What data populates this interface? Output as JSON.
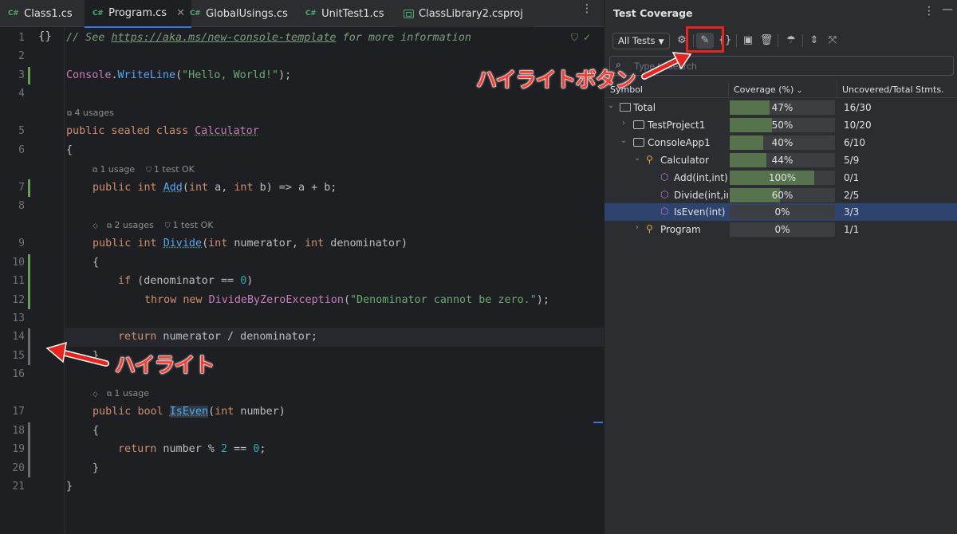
{
  "editor": {
    "tabs": [
      {
        "label": "Class1.cs",
        "icon": "C#"
      },
      {
        "label": "Program.cs",
        "icon": "C#",
        "active": true
      },
      {
        "label": "GlobalUsings.cs",
        "icon": "C#"
      },
      {
        "label": "UnitTest1.cs",
        "icon": "C#"
      },
      {
        "label": "ClassLibrary2.csproj",
        "icon": "project"
      }
    ],
    "close_glyph": "✕",
    "more_glyph": "⋮",
    "braces_icon": "{}",
    "status_icons": [
      "shield-check-icon",
      "check-icon"
    ],
    "line_numbers": [
      "1",
      "2",
      "3",
      "4",
      "5",
      "6",
      "7",
      "8",
      "9",
      "10",
      "11",
      "12",
      "13",
      "14",
      "15",
      "16",
      "17",
      "18",
      "19",
      "20",
      "21"
    ],
    "hints": {
      "h1": "4 usages",
      "h2a": "1 usage",
      "h2b": "1 test OK",
      "h3a": "2 usages",
      "h3b": "1 test OK",
      "h4": "1 usage"
    },
    "code": {
      "l1_comment": "// See ",
      "l1_link": "https://aka.ms/new-console-template",
      "l1_tail": " for more information",
      "l3_a": "Console",
      "l3_b": ".",
      "l3_c": "WriteLine",
      "l3_d": "(",
      "l3_e": "\"Hello, World!\"",
      "l3_f": ");",
      "l5_kw": "public sealed class ",
      "l5_name": "Calculator",
      "l6": "{",
      "l7_kw1": "public ",
      "l7_kw2": "int ",
      "l7_name": "Add",
      "l7_p1": "(",
      "l7_kw3": "int",
      "l7_p2": " a, ",
      "l7_kw4": "int",
      "l7_p3": " b) => a + b;",
      "l9_kw1": "public ",
      "l9_kw2": "int ",
      "l9_name": "Divide",
      "l9_p1": "(",
      "l9_kw3": "int",
      "l9_p2": " numerator, ",
      "l9_kw4": "int",
      "l9_p3": " denominator)",
      "l10": "{",
      "l11_kw": "if",
      "l11_a": " (denominator == ",
      "l11_num": "0",
      "l11_b": ")",
      "l12_kw1": "throw ",
      "l12_kw2": "new ",
      "l12_cls": "DivideByZeroException",
      "l12_a": "(",
      "l12_str": "\"Denominator cannot be zero.\"",
      "l12_b": ");",
      "l14_kw": "return",
      "l14_a": " numerator / denominator;",
      "l15": "}",
      "l17_kw1": "public ",
      "l17_kw2": "bool ",
      "l17_name": "IsEven",
      "l17_p1": "(",
      "l17_kw3": "int",
      "l17_p2": " number)",
      "l18": "{",
      "l19_kw": "return",
      "l19_a": " number % ",
      "l19_n1": "2",
      "l19_b": " == ",
      "l19_n2": "0",
      "l19_c": ";",
      "l20": "}",
      "l21": "}"
    }
  },
  "coverage_panel": {
    "title": "Test Coverage",
    "more_glyph": "⋮",
    "minimize_glyph": "—",
    "scope_dropdown": "All Tests",
    "toolbar_icons": [
      "settings-icon",
      "highlight-coverage-icon",
      "braces-icon",
      "save-icon",
      "delete-icon",
      "run-with-coverage-icon",
      "expand-all-icon",
      "collapse-all-icon"
    ],
    "search_placeholder": "Type to search",
    "columns": {
      "symbol": "Symbol",
      "coverage": "Coverage (%)",
      "stmts": "Uncovered/Total Stmts."
    },
    "rows": [
      {
        "label": "Total",
        "icon": "folder",
        "coverage": 47,
        "coverage_text": "47%",
        "stmts": "16/30",
        "expanded": true
      },
      {
        "label": "TestProject1",
        "icon": "project",
        "coverage": 50,
        "coverage_text": "50%",
        "stmts": "10/20",
        "expanded": false
      },
      {
        "label": "ConsoleApp1",
        "icon": "project",
        "coverage": 40,
        "coverage_text": "40%",
        "stmts": "6/10",
        "expanded": true
      },
      {
        "label": "Calculator",
        "icon": "class",
        "coverage": 44,
        "coverage_text": "44%",
        "stmts": "5/9",
        "expanded": true
      },
      {
        "label": "Add(int,int)",
        "icon": "method",
        "coverage": 100,
        "coverage_text": "100%",
        "stmts": "0/1"
      },
      {
        "label": "Divide(int,int",
        "icon": "method",
        "coverage": 60,
        "coverage_text": "60%",
        "stmts": "2/5"
      },
      {
        "label": "IsEven(int)",
        "icon": "method",
        "coverage": 0,
        "coverage_text": "0%",
        "stmts": "3/3",
        "selected": true
      },
      {
        "label": "Program",
        "icon": "class",
        "coverage": 0,
        "coverage_text": "0%",
        "stmts": "1/1",
        "expanded": false
      }
    ]
  },
  "annotations": {
    "highlight_button_label": "ハイライトボタン",
    "highlight_label": "ハイライト",
    "color": "#e8241c"
  },
  "colors": {
    "coverage_covered": "#6c9c5a",
    "coverage_uncovered": "#43454a",
    "accent": "#3574f0",
    "selection": "#2e436e"
  }
}
